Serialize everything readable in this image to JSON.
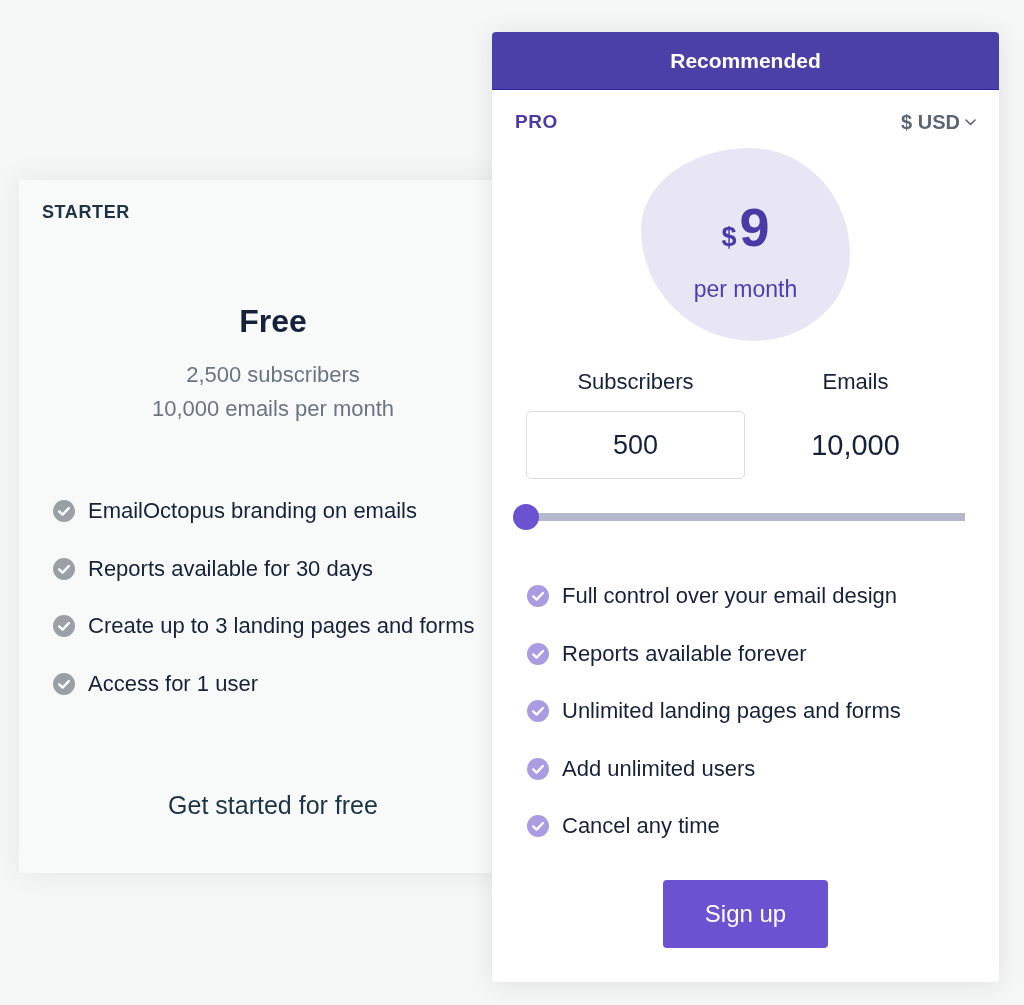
{
  "starter": {
    "name": "STARTER",
    "price": "Free",
    "details": [
      "2,500 subscribers",
      "10,000 emails per month"
    ],
    "features": [
      "EmailOctopus branding on emails",
      "Reports available for 30 days",
      "Create up to 3 landing pages and forms",
      "Access for 1 user"
    ],
    "action": "Get started for free"
  },
  "pro": {
    "banner": "Recommended",
    "name": "PRO",
    "currency": "$ USD",
    "price": {
      "symbol": "$",
      "amount": "9",
      "period": "per month"
    },
    "subscribers": {
      "label": "Subscribers",
      "value": "500"
    },
    "emails": {
      "label": "Emails",
      "value": "10,000"
    },
    "slider": {
      "level": 0
    },
    "features": [
      "Full control over your email design",
      "Reports available forever",
      "Unlimited landing pages and forms",
      "Add unlimited users",
      "Cancel any time"
    ],
    "action": "Sign up"
  }
}
